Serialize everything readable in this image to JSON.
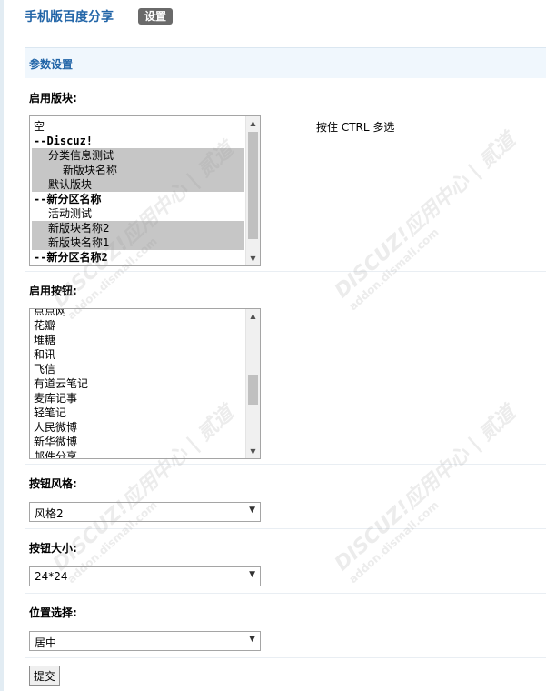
{
  "header": {
    "title": "手机版百度分享",
    "tab_settings": "设置"
  },
  "section": {
    "title": "参数设置"
  },
  "boards": {
    "label": "启用版块:",
    "hint": "按住 CTRL 多选",
    "options": [
      {
        "text": "空",
        "selected": false,
        "group": false,
        "indent": 0
      },
      {
        "text": "--Discuz!",
        "selected": false,
        "group": true,
        "indent": 0
      },
      {
        "text": "分类信息测试",
        "selected": true,
        "group": false,
        "indent": 1
      },
      {
        "text": "新版块名称",
        "selected": true,
        "group": false,
        "indent": 2
      },
      {
        "text": "默认版块",
        "selected": true,
        "group": false,
        "indent": 1
      },
      {
        "text": "--新分区名称",
        "selected": false,
        "group": true,
        "indent": 0
      },
      {
        "text": "活动测试",
        "selected": false,
        "group": false,
        "indent": 1
      },
      {
        "text": "新版块名称2",
        "selected": true,
        "group": false,
        "indent": 1
      },
      {
        "text": "新版块名称1",
        "selected": true,
        "group": false,
        "indent": 1
      },
      {
        "text": "--新分区名称2",
        "selected": false,
        "group": true,
        "indent": 0
      }
    ]
  },
  "buttons": {
    "label": "启用按钮:",
    "options": [
      "点点网",
      "花瓣",
      "堆糖",
      "和讯",
      "飞信",
      "有道云笔记",
      "麦库记事",
      "轻笔记",
      "人民微博",
      "新华微博",
      "邮件分享"
    ]
  },
  "style": {
    "label": "按钮风格:",
    "value": "风格2"
  },
  "size": {
    "label": "按钮大小:",
    "value": "24*24"
  },
  "position": {
    "label": "位置选择:",
    "value": "居中"
  },
  "submit_label": "提交",
  "watermark": {
    "brand": "DISCUZ!应用中心 | 贰道",
    "url": "addon.dismall.com"
  }
}
